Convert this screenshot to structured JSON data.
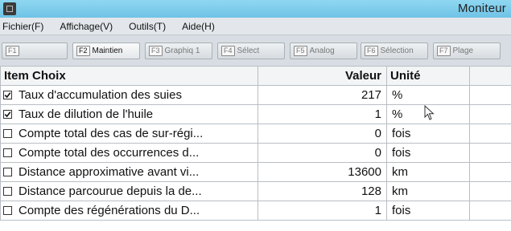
{
  "window": {
    "title": "Moniteur"
  },
  "menu": [
    {
      "label": "Fichier(F)"
    },
    {
      "label": "Affichage(V)"
    },
    {
      "label": "Outils(T)"
    },
    {
      "label": "Aide(H)"
    }
  ],
  "toolbar": {
    "tabs": [
      {
        "key": "F1",
        "label": "",
        "active": false
      },
      {
        "key": "F2",
        "label": "Maintien",
        "active": true
      },
      {
        "key": "F3",
        "label": "Graphiq 1",
        "active": false
      },
      {
        "key": "F4",
        "label": "Sélect",
        "active": false
      },
      {
        "key": "F5",
        "label": "Analog",
        "active": false
      },
      {
        "key": "F6",
        "label": "Sélection",
        "active": false
      },
      {
        "key": "F7",
        "label": "Plage",
        "active": false
      }
    ]
  },
  "table": {
    "headers": {
      "item": "Item Choix",
      "value": "Valeur",
      "unit": "Unité"
    },
    "rows": [
      {
        "checked": true,
        "name": "Taux d'accumulation des suies",
        "value": "217",
        "unit": "%"
      },
      {
        "checked": true,
        "name": "Taux de dilution de l'huile",
        "value": "1",
        "unit": "%"
      },
      {
        "checked": false,
        "name": "Compte total des cas de sur-régi...",
        "value": "0",
        "unit": "fois"
      },
      {
        "checked": false,
        "name": "Compte total des occurrences d...",
        "value": "0",
        "unit": "fois"
      },
      {
        "checked": false,
        "name": "Distance approximative avant vi...",
        "value": "13600",
        "unit": "km"
      },
      {
        "checked": false,
        "name": "Distance parcourue depuis la de...",
        "value": "128",
        "unit": "km"
      },
      {
        "checked": false,
        "name": "Compte des régénérations du D...",
        "value": "1",
        "unit": "fois"
      }
    ]
  },
  "colors": {
    "titlebar": "#7fcdec",
    "grid_line": "#b9bec3"
  },
  "icons": {
    "checked": "check-icon",
    "unchecked": "empty-checkbox-icon"
  }
}
